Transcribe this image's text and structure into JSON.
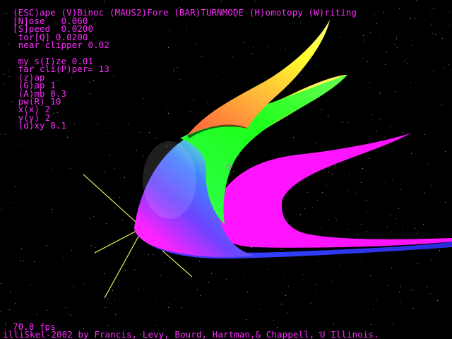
{
  "app": {
    "menu_line": "(ESC)ape (V)Binoc (MAUS2)Fore (BAR)TURNMODE (H)omotopy (W)riting",
    "params": [
      "[N]ose   0.060",
      "[S]peed  0.0200",
      " tor[Q] 0.0200",
      " near clipper 0.02",
      "",
      " my s(I)ze 0.01",
      " far cli(P)per= 13",
      " (z)ap",
      " (G)ap 1",
      " (A)mb 0.3",
      " pw(R) 10",
      " x(x) 2",
      " y(y) 2",
      " (d)xy 0.1"
    ],
    "fps": "70.8 fps",
    "credits": "illiSkel-2002 by Francis, Levy, Bourd, Hartman,& Chappell, U Illinois."
  },
  "colors": {
    "text": "#ff2cff",
    "background": "#000000",
    "axes": "#ffff66"
  }
}
